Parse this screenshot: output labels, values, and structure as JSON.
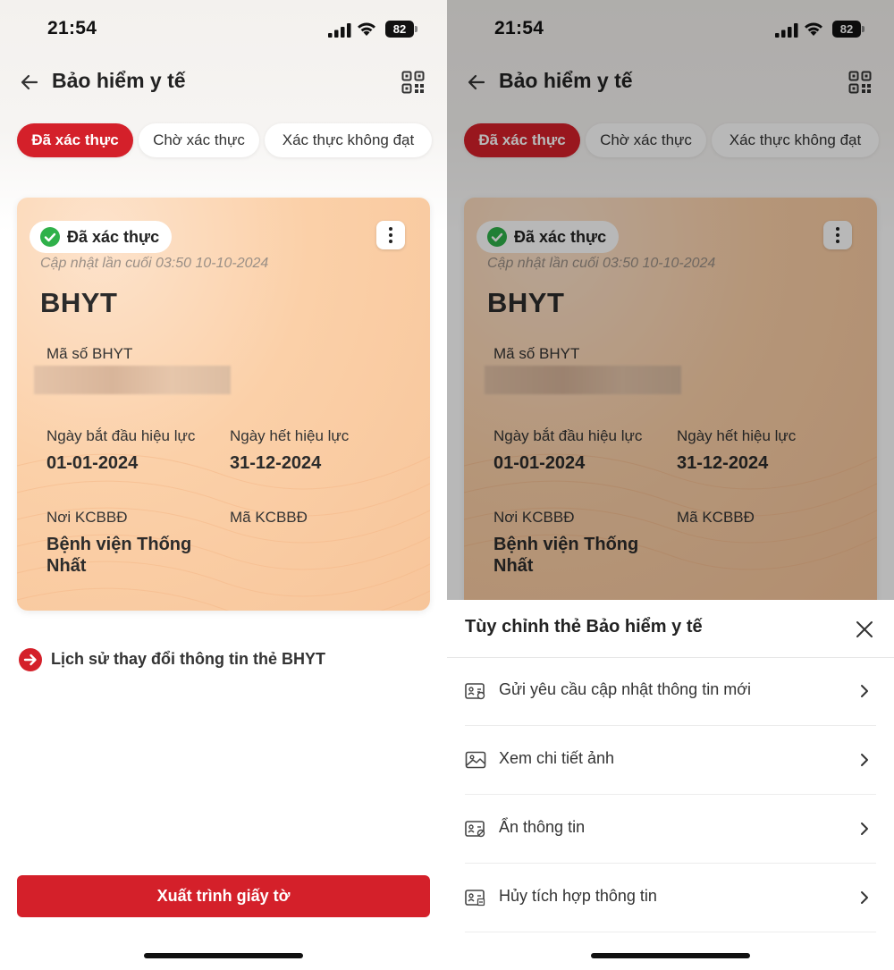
{
  "status_bar": {
    "time": "21:54",
    "battery": "82"
  },
  "header": {
    "title": "Bảo hiểm y tế"
  },
  "tabs": [
    {
      "label": "Đã xác thực"
    },
    {
      "label": "Chờ xác thực"
    },
    {
      "label": "Xác thực không đạt"
    }
  ],
  "card": {
    "status": "Đã xác thực",
    "updated": "Cập nhật lần cuối 03:50 10-10-2024",
    "type": "BHYT",
    "id_label": "Mã số BHYT",
    "start_label": "Ngày bắt đầu hiệu lực",
    "start_value": "01-01-2024",
    "end_label": "Ngày hết hiệu lực",
    "end_value": "31-12-2024",
    "facility_label": "Nơi KCBBĐ",
    "facility_value_line1": "Bệnh viện Thống",
    "facility_value_line2": "Nhất",
    "facility_code_label": "Mã KCBBĐ"
  },
  "history_link": "Lịch sử thay đổi thông tin thẻ BHYT",
  "present_button": "Xuất trình giấy tờ",
  "sheet": {
    "title": "Tùy chỉnh thẻ Bảo hiểm y tế",
    "options": [
      {
        "label": "Gửi yêu cầu cập nhật thông tin mới",
        "icon": "id-card-refresh-icon"
      },
      {
        "label": "Xem chi tiết ảnh",
        "icon": "image-icon"
      },
      {
        "label": "Ẩn thông tin",
        "icon": "id-card-hide-icon"
      },
      {
        "label": "Hủy tích hợp thông tin",
        "icon": "id-card-remove-icon"
      }
    ]
  },
  "colors": {
    "accent": "#d4202a",
    "success": "#2fb14a",
    "card": "#f9c9a0"
  }
}
